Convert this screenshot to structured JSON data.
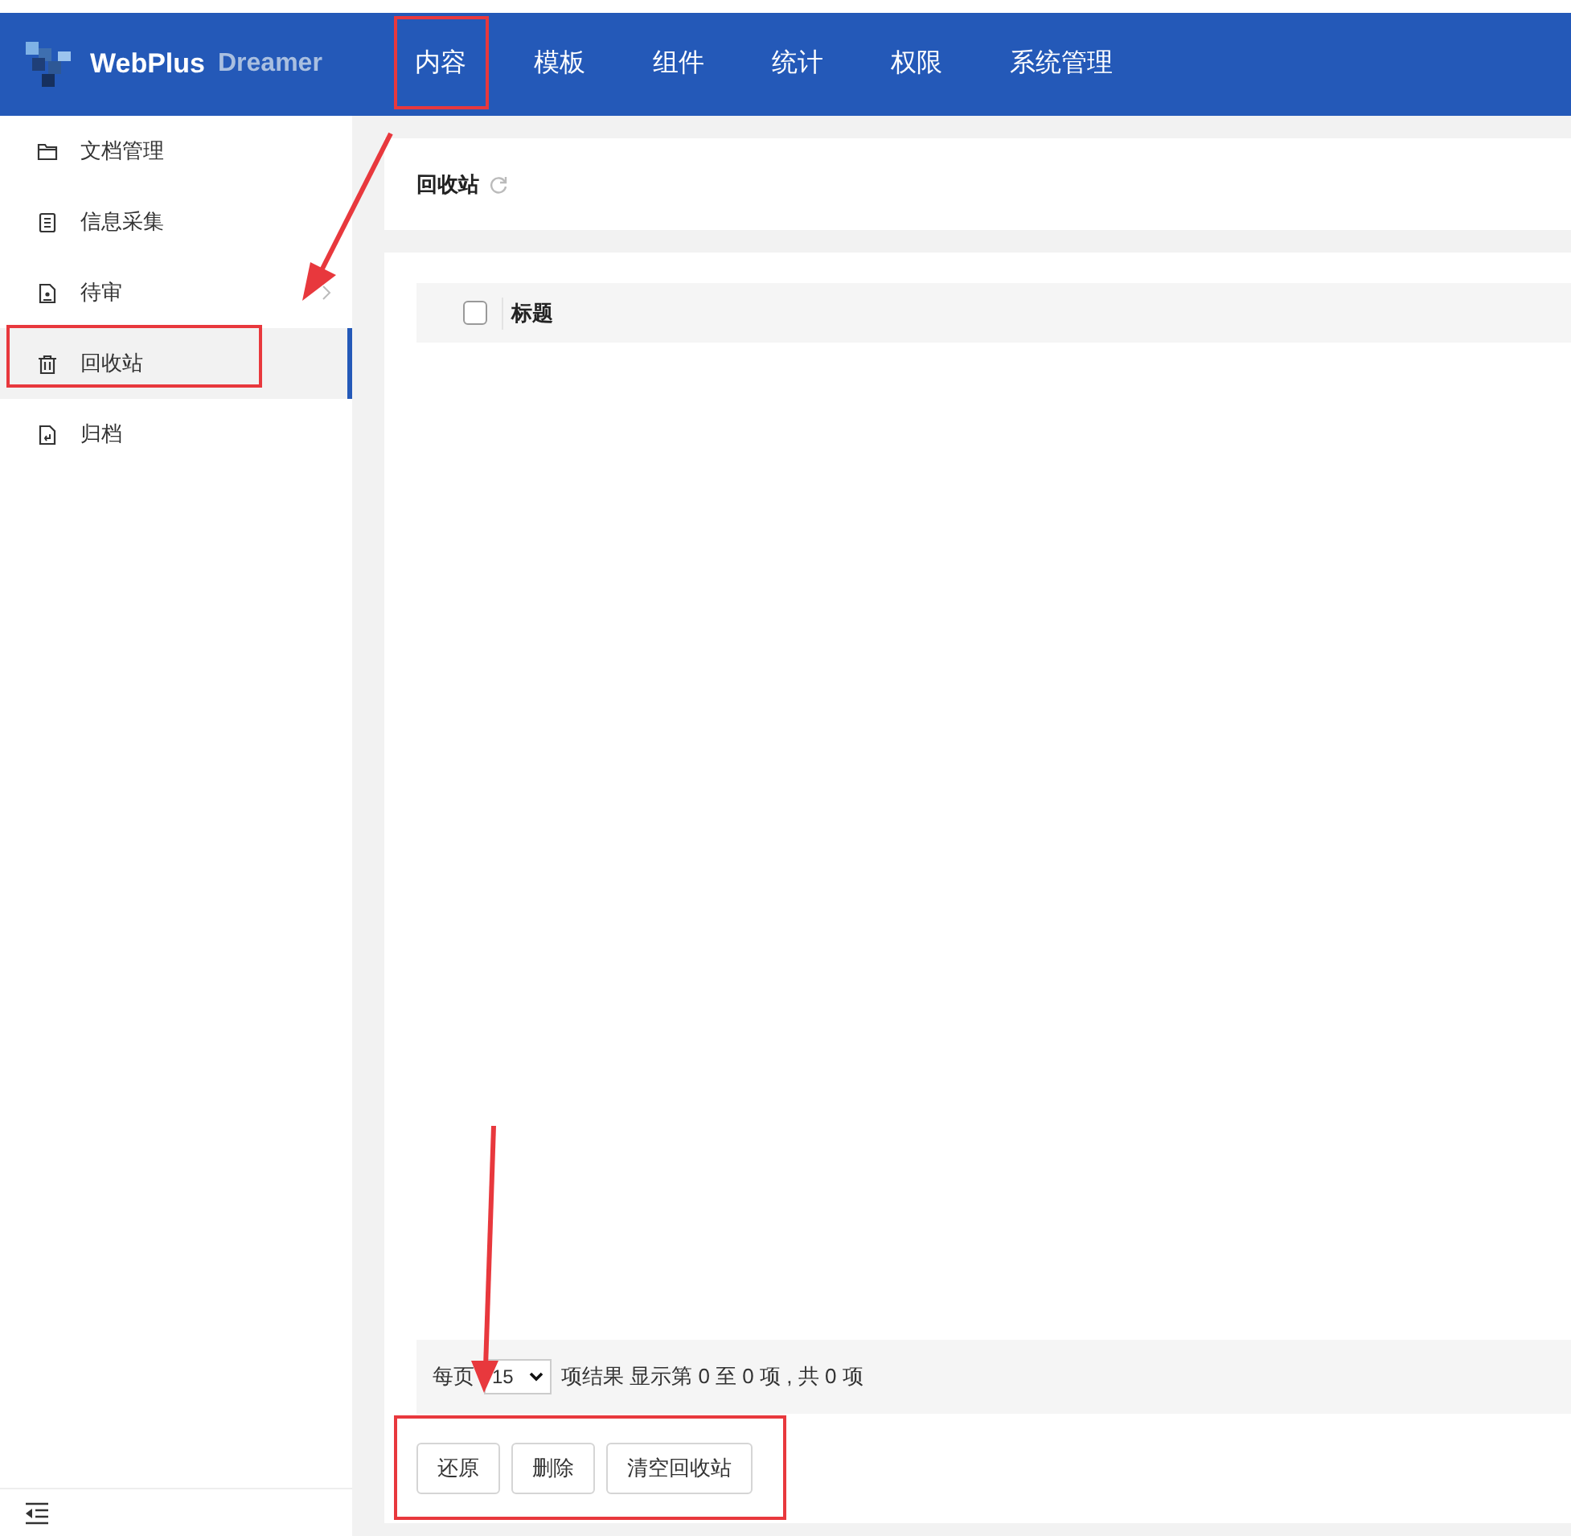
{
  "header": {
    "logo_text": "WebPlus",
    "logo_subtext": "Dreamer",
    "nav": [
      {
        "label": "内容"
      },
      {
        "label": "模板"
      },
      {
        "label": "组件"
      },
      {
        "label": "统计"
      },
      {
        "label": "权限"
      },
      {
        "label": "系统管理"
      }
    ]
  },
  "sidebar": {
    "items": [
      {
        "label": "文档管理",
        "selected": false
      },
      {
        "label": "信息采集",
        "selected": false
      },
      {
        "label": "待审",
        "selected": false,
        "expanded": false
      },
      {
        "label": "回收站",
        "selected": true
      },
      {
        "label": "归档",
        "selected": false
      }
    ]
  },
  "page_title": "回收站",
  "table": {
    "columns": [
      "标题"
    ],
    "select_all_checked": false
  },
  "pagination": {
    "per_page_label": "每页",
    "per_page_value": "15",
    "summary": "项结果 显示第 0 至 0 项 , 共 0 项"
  },
  "buttons": [
    "还原",
    "删除",
    "清空回收站"
  ]
}
